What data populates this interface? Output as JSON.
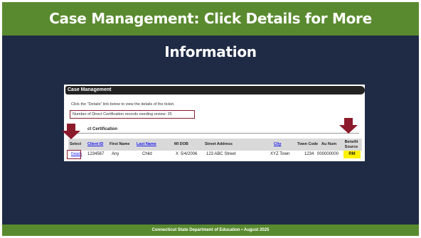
{
  "slide": {
    "title": "Case Management: Click Details for More Information",
    "footer": "Connecticut State Department of Education • August 2025"
  },
  "screenshot": {
    "header": "Case Management",
    "instruction": "Click the \"Details\" link below to view the details of the ticket.",
    "records_notice": "Number of Direct Certification records needing review: 25",
    "section_title": "ct Certification",
    "columns": {
      "select": "Select",
      "client_id": "Client ID",
      "first_name": "First Name",
      "last_name": "Last Name",
      "mi_dob": "MI DOB",
      "street_address": "Street Address",
      "city": "City",
      "town_code": "Town Code",
      "au_num": "Au Num",
      "benefit_source": "Benefit Source"
    },
    "row": {
      "details": "Details",
      "client_id": "1234567",
      "first_name": "Any",
      "last_name": "Child",
      "mi": "X",
      "dob": "5/4/2006",
      "street_address": "123 ABC Street",
      "city": "XYZ Town",
      "town_code": "1234",
      "au_num": "000000000",
      "benefit_source": "RM"
    }
  },
  "colors": {
    "slide_background": "#1f2a44",
    "title_bar": "#5a8a2f",
    "highlight_border": "#8b1a2b",
    "arrow": "#8b1a2b",
    "benefit_highlight": "#fff200"
  },
  "icons": [
    "down-arrow-icon",
    "down-arrow-icon"
  ]
}
